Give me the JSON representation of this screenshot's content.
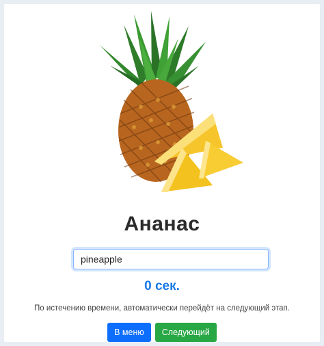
{
  "card": {
    "image_icon": "pineapple-illustration",
    "title": "Ананас",
    "answer_input": {
      "value": "pineapple",
      "placeholder": ""
    },
    "timer": "0 сек.",
    "hint": "По истечению времени, автоматически перейдёт на следующий этап.",
    "menu_button": "В меню",
    "next_button": "Следующий"
  },
  "colors": {
    "page_bg": "#e9edf4",
    "timer": "#1a7ae8",
    "menu_button": "#0d6efd",
    "next_button": "#28a745"
  }
}
